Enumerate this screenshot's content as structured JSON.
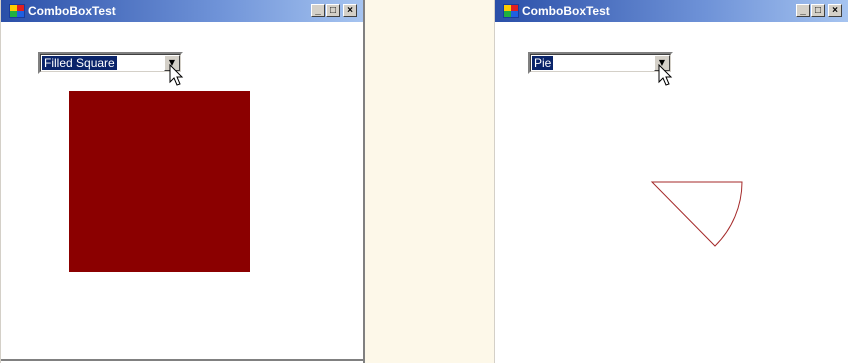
{
  "windows": [
    {
      "title": "ComboBoxTest",
      "combo_value": "Filled Square",
      "shape_color": "#8b0000"
    },
    {
      "title": "ComboBoxTest",
      "combo_value": "Pie",
      "shape_color": "#a52a2a"
    }
  ],
  "titlebar_buttons": {
    "minimize": "_",
    "maximize": "□",
    "close": "×"
  },
  "colors": {
    "title_gradient_start": "#2a4fa8",
    "selection": "#0a246a",
    "background": "#fdf8e9"
  }
}
